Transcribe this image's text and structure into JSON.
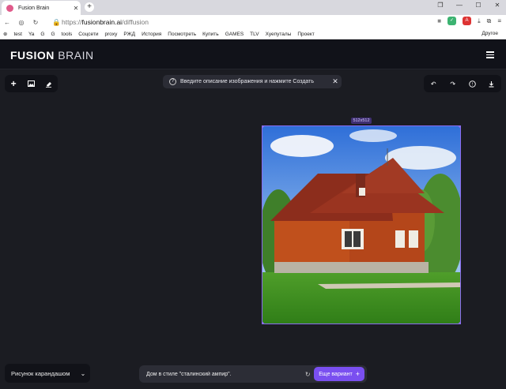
{
  "browser": {
    "tab_title": "Fusion Brain",
    "url_scheme": "https://",
    "url_host": "fusionbrain.ai",
    "url_path": "/diffusion",
    "bookmarks": [
      "test",
      "Ya",
      "G",
      "G",
      "tools",
      "Соцсети",
      "proxy",
      "РЖД",
      "История",
      "Посмотреть",
      "Купить",
      "GAMES",
      "TLV",
      "Хуепуталы",
      "Проект"
    ],
    "bookmarks_other": "Другое"
  },
  "app": {
    "logo_bold": "FUSION",
    "logo_light": "BRAIN"
  },
  "hint": {
    "text": "Введите описание изображения и нажмите Создать"
  },
  "canvas": {
    "size_tag": "512x512"
  },
  "bottom": {
    "style_label": "Рисунок карандашом",
    "prompt_text": "Дом в стиле \"сталинский ампир\".",
    "generate_label": "Еще вариант"
  },
  "colors": {
    "accent": "#7a4ff0",
    "selection": "#8a6cf0",
    "background": "#1b1c22"
  }
}
